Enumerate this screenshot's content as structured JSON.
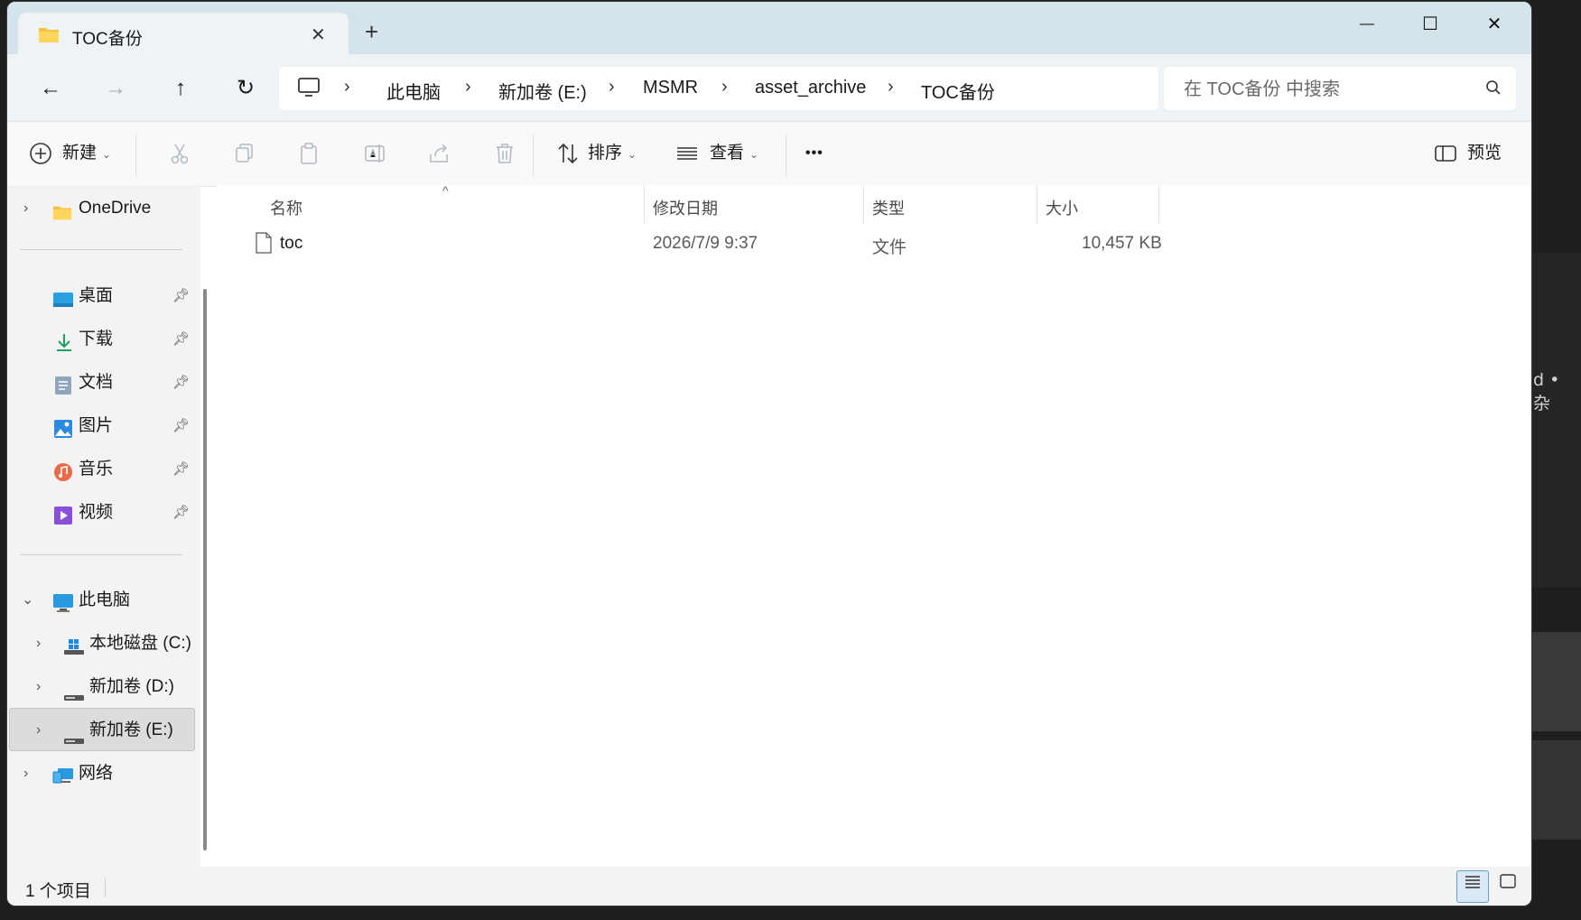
{
  "background": {
    "text_right": "d • 杂"
  },
  "tab": {
    "title": "TOC备份",
    "close": "✕",
    "new_tab": "+"
  },
  "window_controls": {
    "minimize": "—",
    "maximize": "☐",
    "close": "✕"
  },
  "nav": {
    "back": "←",
    "forward": "→",
    "up": "↑",
    "refresh": "↻"
  },
  "breadcrumb": [
    "此电脑",
    "新加卷 (E:)",
    "MSMR",
    "asset_archive",
    "TOC备份"
  ],
  "breadcrumb_separator": "›",
  "search": {
    "placeholder": "在 TOC备份 中搜索"
  },
  "toolbar": {
    "new_label": "新建",
    "sort_label": "排序",
    "view_label": "查看",
    "more_label": "•••",
    "preview_label": "预览"
  },
  "sidebar": {
    "onedrive": "OneDrive",
    "quick_access": [
      {
        "label": "桌面",
        "icon": "desktop-icon"
      },
      {
        "label": "下载",
        "icon": "download-icon"
      },
      {
        "label": "文档",
        "icon": "documents-icon"
      },
      {
        "label": "图片",
        "icon": "pictures-icon"
      },
      {
        "label": "音乐",
        "icon": "music-icon"
      },
      {
        "label": "视频",
        "icon": "videos-icon"
      }
    ],
    "this_pc": "此电脑",
    "drives": [
      "本地磁盘 (C:)",
      "新加卷 (D:)",
      "新加卷 (E:)"
    ],
    "network": "网络",
    "selected": "新加卷 (E:)"
  },
  "columns": {
    "name": "名称",
    "modified": "修改日期",
    "type": "类型",
    "size": "大小"
  },
  "files": [
    {
      "name": "toc",
      "modified": "2026/7/9 9:37",
      "type": "文件",
      "size": "10,457 KB"
    }
  ],
  "status": {
    "item_count": "1 个项目"
  },
  "colors": {
    "titlebar": "#d4e4ea",
    "navbar": "#eef3f6",
    "sidebar": "#f3f3f3",
    "accent": "#0067c0"
  }
}
